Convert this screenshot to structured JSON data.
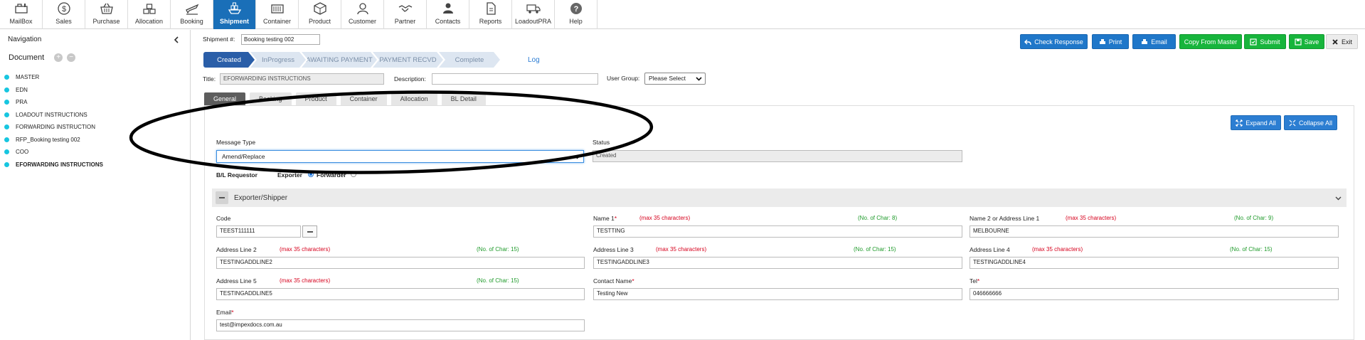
{
  "toolbar": {
    "items": [
      {
        "label": "MailBox",
        "icon": "mailbox-icon"
      },
      {
        "label": "Sales",
        "icon": "dollar-icon"
      },
      {
        "label": "Purchase",
        "icon": "basket-icon"
      },
      {
        "label": "Allocation",
        "icon": "boxes-icon"
      },
      {
        "label": "Booking",
        "icon": "plane-icon"
      },
      {
        "label": "Shipment",
        "icon": "ship-icon",
        "active": true
      },
      {
        "label": "Container",
        "icon": "container-icon"
      },
      {
        "label": "Product",
        "icon": "product-box-icon"
      },
      {
        "label": "Customer",
        "icon": "customer-icon"
      },
      {
        "label": "Partner",
        "icon": "handshake-icon"
      },
      {
        "label": "Contacts",
        "icon": "contacts-icon"
      },
      {
        "label": "Reports",
        "icon": "report-icon"
      },
      {
        "label": "LoadoutPRA",
        "icon": "truck-icon"
      },
      {
        "label": "Help",
        "icon": "help-icon"
      }
    ]
  },
  "sidebar": {
    "title": "Navigation",
    "document_header": "Document",
    "documents": [
      {
        "label": "MASTER"
      },
      {
        "label": "EDN"
      },
      {
        "label": "PRA"
      },
      {
        "label": "LOADOUT INSTRUCTIONS"
      },
      {
        "label": "FORWARDING INSTRUCTION"
      },
      {
        "label": "RFP_Booking testing 002"
      },
      {
        "label": "COO"
      },
      {
        "label": "EFORWARDING INSTRUCTIONS",
        "active": true
      }
    ]
  },
  "header": {
    "shipment_label": "Shipment #:",
    "shipment_value": "Booking testing 002",
    "buttons": {
      "check_response": "Check Response",
      "print": "Print",
      "email": "Email",
      "copy_from_master": "Copy From Master",
      "submit": "Submit",
      "save": "Save",
      "exit": "Exit"
    }
  },
  "workflow": {
    "steps": [
      "Created",
      "InProgress",
      "AWAITING PAYMENT",
      "PAYMENT RECVD",
      "Complete"
    ],
    "current": "Created",
    "log_label": "Log"
  },
  "meta": {
    "title_label": "Title:",
    "title_value": "EFORWARDING INSTRUCTIONS",
    "description_label": "Description:",
    "description_value": "",
    "user_group_label": "User Group:",
    "user_group_value": "Please Select"
  },
  "tabs": [
    "General",
    "Booking",
    "Product",
    "Container",
    "Allocation",
    "BL Detail"
  ],
  "panel": {
    "expand_all": "Expand All",
    "collapse_all": "Collapse All",
    "message_type_label": "Message Type",
    "message_type_value": "Amend/Replace",
    "status_label": "Status",
    "status_value": "Created",
    "bl_requestor_label": "B/L Requestor",
    "exporter_label": "Exporter",
    "forwarder_label": "Forwarder"
  },
  "exporter": {
    "section_title": "Exporter/Shipper",
    "max_chars": "(max 35 characters)",
    "code_label": "Code",
    "code_value": "TEEST111111",
    "name1_label": "Name 1",
    "name1_count": "(No. of Char: 8)",
    "name1_value": "TESTTING",
    "name2_label": "Name 2 or Address Line 1",
    "name2_count": "(No. of Char: 9)",
    "name2_value": "MELBOURNE",
    "addr2_label": "Address Line 2",
    "addr2_count": "(No. of Char: 15)",
    "addr2_value": "TESTINGADDLINE2",
    "addr3_label": "Address Line 3",
    "addr3_count": "(No. of Char: 15)",
    "addr3_value": "TESTINGADDLINE3",
    "addr4_label": "Address Line 4",
    "addr4_count": "(No. of Char: 15)",
    "addr4_value": "TESTINGADDLINE4",
    "addr5_label": "Address Line 5",
    "addr5_count": "(No. of Char: 15)",
    "addr5_value": "TESTINGADDLINE5",
    "contact_label": "Contact Name",
    "contact_value": "Testing New",
    "tel_label": "Tel",
    "tel_value": "046666666",
    "email_label": "Email",
    "email_value": "test@impexdocs.com.au",
    "required_mark": "*"
  },
  "colors": {
    "toolbar_active": "#1a6fb8",
    "primary_button": "#1f77c9",
    "success_button": "#17b53c",
    "workflow_current": "#2a5ea8",
    "document_dot": "#17c6e0",
    "required_text": "#d6001c",
    "char_count_text": "#1e9a2a"
  }
}
